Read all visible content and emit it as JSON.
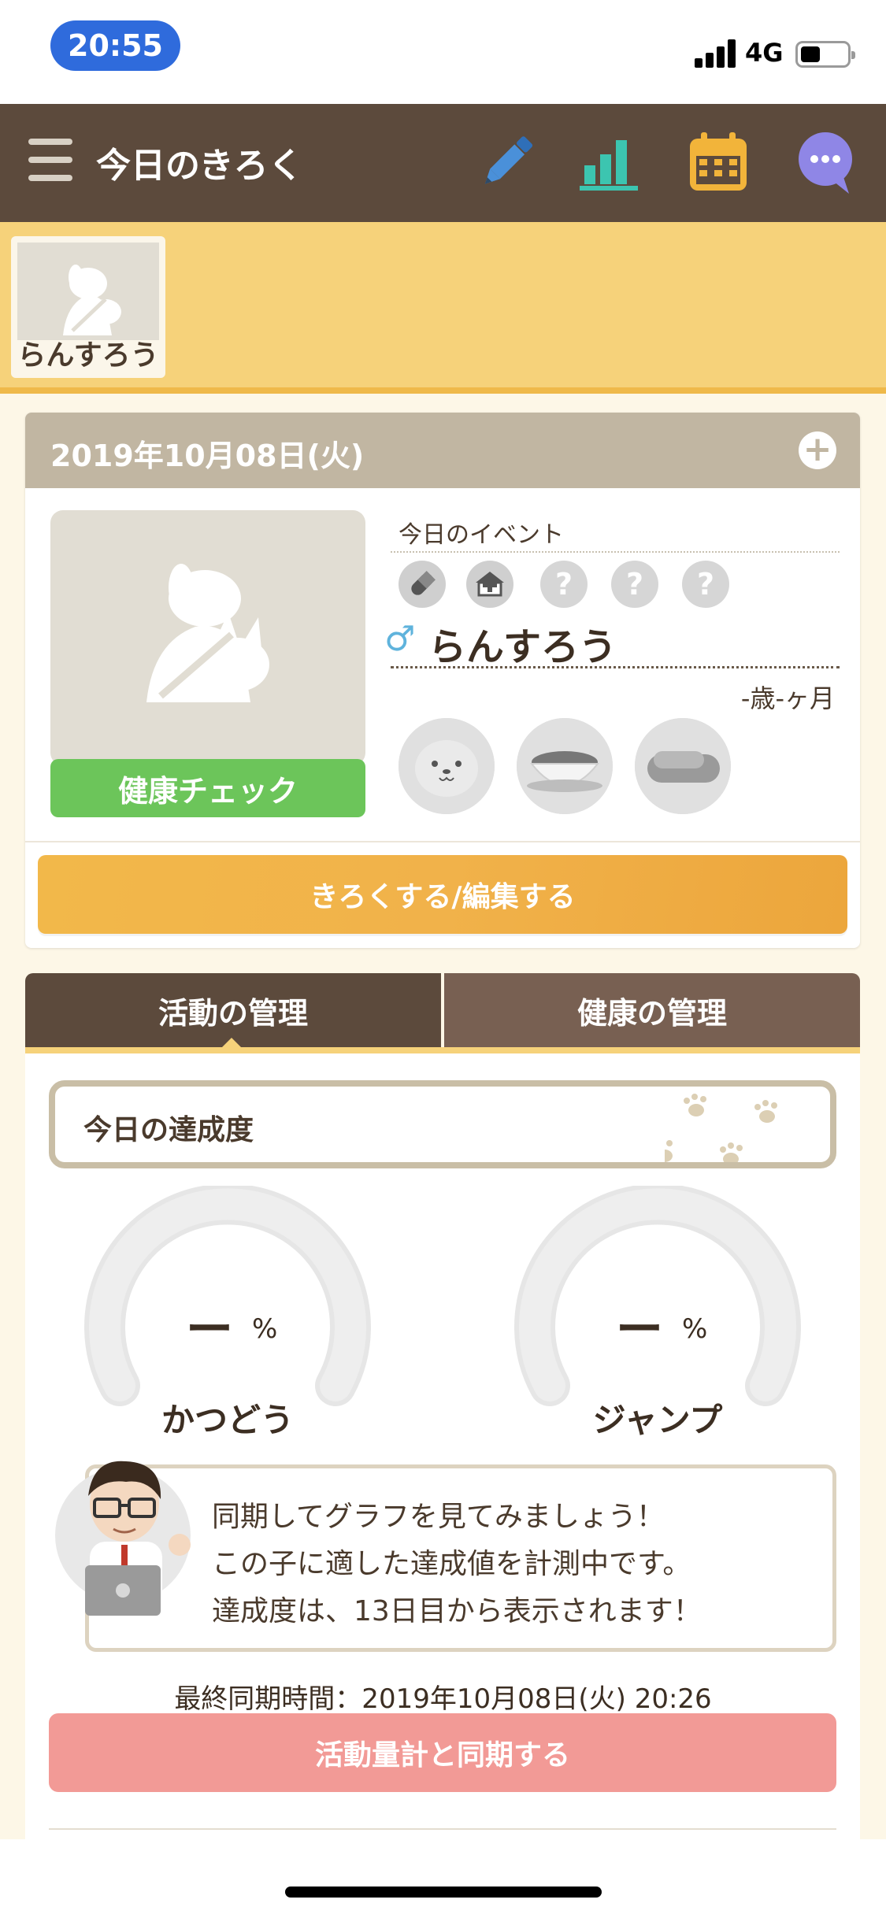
{
  "status_bar": {
    "time": "20:55",
    "network": "4G"
  },
  "header": {
    "title": "今日のきろく",
    "icons": [
      "menu-icon",
      "pencil-icon",
      "bar-chart-icon",
      "calendar-icon",
      "chat-icon"
    ],
    "colors": {
      "bar": "#5c4a3c",
      "pencil": "#4a90d9",
      "chart": "#3cc5b0",
      "calendar": "#f2b43a",
      "chat": "#8f86e6"
    }
  },
  "pet_tab": {
    "name": "らんすろう"
  },
  "date_card": {
    "date": "2019年10月08日(火)",
    "health_check_label": "健康チェック",
    "event_label": "今日のイベント",
    "event_icons": [
      "pill-icon",
      "hospital-icon",
      "unknown-icon",
      "unknown-icon",
      "unknown-icon"
    ],
    "unknown_glyph": "?",
    "gender_symbol": "♂",
    "pet_name": "らんすろう",
    "age": "-歳-ヶ月",
    "status_icons": [
      "face-icon",
      "food-bowl-icon",
      "bed-icon"
    ],
    "record_button": "きろくする/編集する"
  },
  "tabs": {
    "activity": "活動の管理",
    "health": "健康の管理",
    "active": "activity"
  },
  "achievement": {
    "title": "今日の達成度",
    "gauges": [
      {
        "value": "ー",
        "unit": "%",
        "label": "かつどう"
      },
      {
        "value": "ー",
        "unit": "%",
        "label": "ジャンプ"
      }
    ]
  },
  "advice": {
    "lines": [
      "同期してグラフを見てみましょう！",
      "この子に適した達成値を計測中です。",
      "達成度は、13日目から表示されます！"
    ]
  },
  "sync": {
    "last_sync": "最終同期時間：2019年10月08日(火) 20:26",
    "button": "活動量計と同期する"
  }
}
